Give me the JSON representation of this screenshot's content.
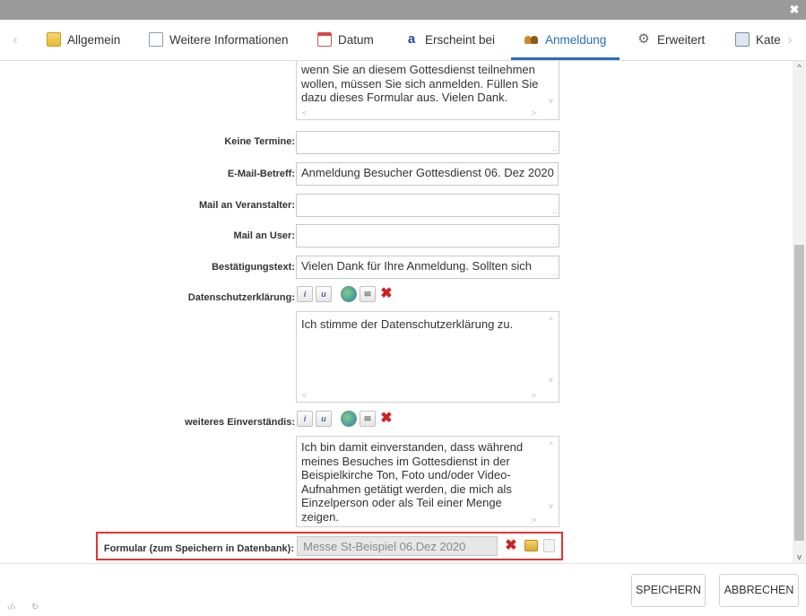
{
  "window": {
    "close_glyph": "✖"
  },
  "tabs": [
    {
      "label": "Allgemein",
      "icon": "folder-icon"
    },
    {
      "label": "Weitere Informationen",
      "icon": "document-icon"
    },
    {
      "label": "Datum",
      "icon": "calendar-icon"
    },
    {
      "label": "Erscheint bei",
      "icon": "text-icon"
    },
    {
      "label": "Anmeldung",
      "icon": "people-icon",
      "active": true
    },
    {
      "label": "Erweitert",
      "icon": "gear-icon"
    },
    {
      "label": "Kate",
      "icon": "category-icon"
    }
  ],
  "tab_arrows": {
    "left": "‹",
    "right": "›"
  },
  "form": {
    "intro_text": "wenn Sie an diesem Gottesdienst teilnehmen wollen, müssen Sie sich anmelden. Füllen Sie dazu dieses Formular aus. Vielen Dank.",
    "keine_termine": {
      "label": "Keine Termine:",
      "value": ""
    },
    "email_betreff": {
      "label": "E-Mail-Betreff:",
      "value": "Anmeldung Besucher Gottesdienst 06. Dez 2020"
    },
    "mail_veranstalter": {
      "label": "Mail an Veranstalter:",
      "value": ""
    },
    "mail_user": {
      "label": "Mail an User:",
      "value": ""
    },
    "bestaetigung": {
      "label": "Bestätigungstext:",
      "value": "Vielen Dank für Ihre Anmeldung. Sollten sich"
    },
    "datenschutz": {
      "label": "Datenschutzerklärung:",
      "value": "Ich stimme der Datenschutzerklärung zu."
    },
    "einverstaendnis": {
      "label": "weiteres Einverständis:",
      "value": "Ich bin damit einverstanden, dass während meines Besuches im Gottesdienst in der Beispielkirche Ton, Foto und/oder Video-Aufnahmen getätigt werden, die mich als Einzelperson oder als Teil einer Menge zeigen."
    },
    "formular": {
      "label": "Formular (zum Speichern in Datenbank):",
      "value": "Messe St-Beispiel 06.Dez 2020"
    }
  },
  "toolbar_glyphs": {
    "info": "i",
    "user": "u",
    "mail": "✉",
    "delete": "✖"
  },
  "scroll_glyphs": {
    "up": "^",
    "down": "v",
    "left": "<",
    "right": ">",
    "grip": ".:"
  },
  "footer": {
    "save": "SPEICHERN",
    "cancel": "ABBRECHEN",
    "code_glyph": "‹/›",
    "refresh_glyph": "↻"
  },
  "colors": {
    "accent": "#2a6dbb",
    "highlight": "#e23535",
    "delete": "#d02020"
  }
}
